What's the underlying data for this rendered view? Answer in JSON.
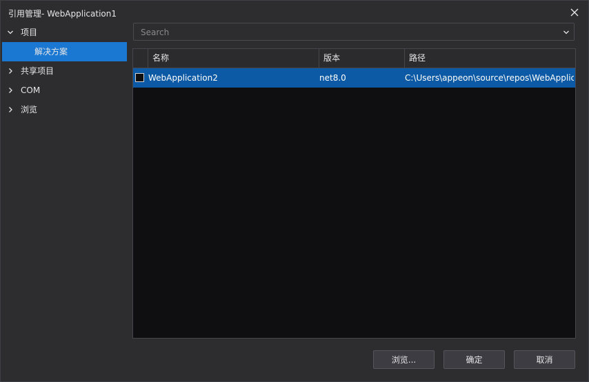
{
  "window": {
    "title": "引用管理- WebApplication1"
  },
  "tree": {
    "items": [
      {
        "label": "项目",
        "expanded": true,
        "icon": "chevron-down-icon"
      },
      {
        "label": "解决方案",
        "selected": true
      },
      {
        "label": "共享项目",
        "expanded": false,
        "icon": "chevron-right-icon"
      },
      {
        "label": "COM",
        "expanded": false,
        "icon": "chevron-right-icon"
      },
      {
        "label": "浏览",
        "expanded": false,
        "icon": "chevron-right-icon"
      }
    ]
  },
  "search": {
    "placeholder": "Search",
    "value": ""
  },
  "table": {
    "columns": [
      "名称",
      "版本",
      "路径"
    ],
    "rows": [
      {
        "checked": false,
        "name": "WebApplication2",
        "version": "net8.0",
        "path": "C:\\Users\\appeon\\source\\repos\\WebApplicati..."
      }
    ]
  },
  "buttons": {
    "browse": "浏览...",
    "ok": "确定",
    "cancel": "取消"
  },
  "colors": {
    "background": "#2d2d30",
    "selection": "#1a78d3",
    "row_selection": "#0c5aa6",
    "grid_background": "#0f0f12"
  }
}
